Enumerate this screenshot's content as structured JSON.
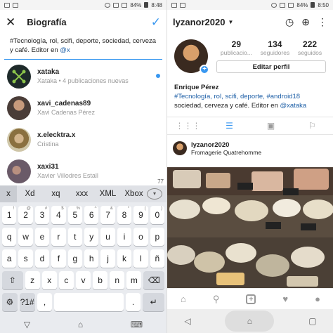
{
  "left": {
    "status": {
      "time": "8:48",
      "battery": "84%"
    },
    "header": {
      "title": "Biografía",
      "close": "✕",
      "confirm": "✓"
    },
    "bio_text": "#Tecnología, rol, scifi, deporte, sociedad, cerveza y café. Editor en ",
    "bio_mention": "@x",
    "suggestions": [
      {
        "username": "xataka",
        "subtitle": "Xataka • 4 publicaciones nuevas",
        "avatar_color": "#1e2a2a"
      },
      {
        "username": "xavi_cadenas89",
        "subtitle": "Xavi Cadenas Pérez",
        "avatar_color": "#6b5a50"
      },
      {
        "username": "x.elecktra.x",
        "subtitle": "Cristina",
        "avatar_color": "#a08560"
      },
      {
        "username": "xaxi31",
        "subtitle": "Xavier Villodres Estall",
        "avatar_color": "#7a6a70"
      }
    ],
    "char_count": "77",
    "keyboard": {
      "predictions": [
        "x",
        "Xd",
        "xq",
        "xxx",
        "XML",
        "Xbox"
      ],
      "row_numbers": [
        {
          "k": "1",
          "s": "!"
        },
        {
          "k": "2",
          "s": "@"
        },
        {
          "k": "3",
          "s": "#"
        },
        {
          "k": "4",
          "s": "$"
        },
        {
          "k": "5",
          "s": "%"
        },
        {
          "k": "6",
          "s": "^"
        },
        {
          "k": "7",
          "s": "&"
        },
        {
          "k": "8",
          "s": "*"
        },
        {
          "k": "9",
          "s": "("
        },
        {
          "k": "0",
          "s": ")"
        }
      ],
      "row1": [
        "q",
        "w",
        "e",
        "r",
        "t",
        "y",
        "u",
        "i",
        "o",
        "p"
      ],
      "row2": [
        "a",
        "s",
        "d",
        "f",
        "g",
        "h",
        "j",
        "k",
        "l",
        "ñ"
      ],
      "row3": [
        "z",
        "x",
        "c",
        "v",
        "b",
        "n",
        "m"
      ],
      "shift": "⇧",
      "backspace": "⌫",
      "settings": "⚙",
      "symbols": "?1#",
      "comma": ",",
      "period": ".",
      "enter": "↵"
    }
  },
  "right": {
    "status": {
      "time": "8:50",
      "battery": "84%"
    },
    "header": {
      "username": "lyzanor2020"
    },
    "stats": [
      {
        "value": "29",
        "label": "publicacio..."
      },
      {
        "value": "134",
        "label": "seguidores"
      },
      {
        "value": "222",
        "label": "seguidos"
      }
    ],
    "edit_button": "Editar perfil",
    "bio": {
      "name": "Enrique Pérez",
      "line1": "#Tecnología, rol, scifi, deporte, #android18",
      "line2_pre": "sociedad, cerveza y café. Editor en ",
      "line2_mention": "@xataka"
    },
    "post": {
      "username": "lyzanor2020",
      "location": "Fromagerie Quatrehomme"
    },
    "colors": {
      "accent": "#3897f0",
      "link": "#1c5ea6"
    }
  }
}
